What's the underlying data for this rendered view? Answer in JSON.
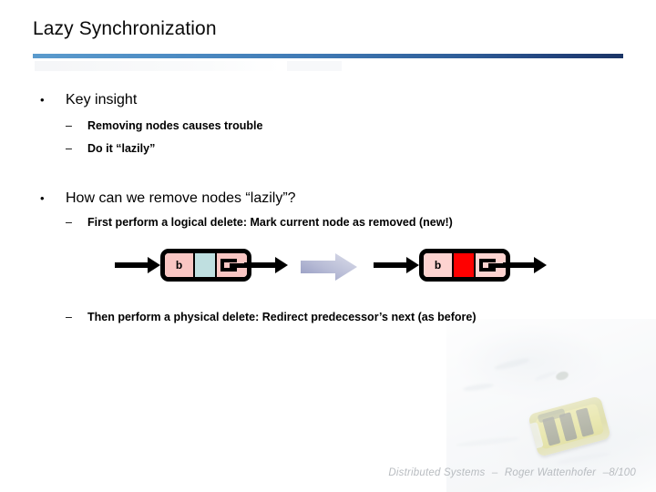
{
  "slide": {
    "title": "Lazy Synchronization",
    "bullets": [
      {
        "marker": "•",
        "text": "Key insight",
        "sub": [
          {
            "marker": "–",
            "text": "Removing nodes causes trouble"
          },
          {
            "marker": "–",
            "text": "Do it “lazily”"
          }
        ]
      },
      {
        "marker": "•",
        "text": "How can we remove nodes “lazily”?",
        "sub": [
          {
            "marker": "–",
            "text": "First perform a logical delete: Mark current node as removed (new!)"
          },
          {
            "marker": "–",
            "text": "Then perform a physical delete: Redirect predecessor’s next (as before)"
          }
        ]
      }
    ]
  },
  "diagram": {
    "node_before": {
      "key_label": "b",
      "body_color": "#f9c6c3",
      "mark_color": "#bfdfe0",
      "border_color": "#000000"
    },
    "node_after": {
      "key_label": "b",
      "body_color": "#fdd3d0",
      "mark_color": "#ff0000",
      "border_color": "#000000"
    },
    "transition_arrow": {
      "name": "gray-block-arrow",
      "color_start": "#9a9fc4",
      "color_end": "#d7d9e8"
    },
    "link_arrow_color": "#000000"
  },
  "footer": {
    "course": "Distributed Systems",
    "separator": "–",
    "author": "Roger Wattenhofer",
    "page": "–8/100"
  },
  "theme": {
    "rule_gradient_start": "#5b9bcd",
    "rule_gradient_end": "#1b3566",
    "footer_color": "#b8bcc0"
  }
}
